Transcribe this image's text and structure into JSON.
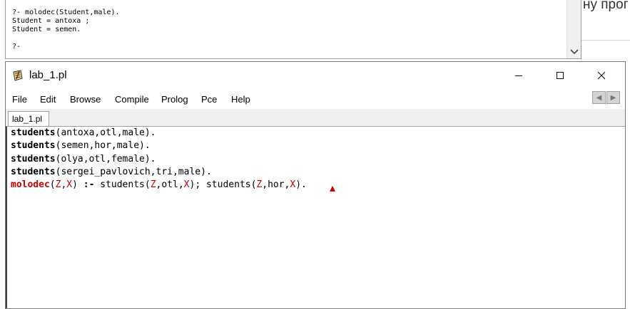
{
  "background_page": {
    "fragment_text": "ну прог"
  },
  "console": {
    "lines": [
      "?- molodec(Student,male).",
      "Student = antoxa ;",
      "Student = semen.",
      "",
      "?-"
    ]
  },
  "editor": {
    "title": "lab_1.pl",
    "window_controls": {
      "minimize": "—",
      "maximize": "☐",
      "close": "✕"
    },
    "menu": [
      "File",
      "Edit",
      "Browse",
      "Compile",
      "Prolog",
      "Pce",
      "Help"
    ],
    "tab_label": "lab_1.pl",
    "code": [
      [
        {
          "t": "students",
          "c": "pred"
        },
        {
          "t": "(antoxa,otl,male)."
        }
      ],
      [
        {
          "t": "students",
          "c": "pred"
        },
        {
          "t": "(semen,hor,male)."
        }
      ],
      [
        {
          "t": "students",
          "c": "pred"
        },
        {
          "t": "(olya,otl,female)."
        }
      ],
      [
        {
          "t": "students",
          "c": "pred"
        },
        {
          "t": "(sergei_pavlovich,tri,male)."
        }
      ],
      [
        {
          "t": "molodec",
          "c": "head"
        },
        {
          "t": "("
        },
        {
          "t": "Z",
          "c": "var"
        },
        {
          "t": ","
        },
        {
          "t": "X",
          "c": "var"
        },
        {
          "t": ") "
        },
        {
          "t": ":-",
          "c": "op"
        },
        {
          "t": " students("
        },
        {
          "t": "Z",
          "c": "var"
        },
        {
          "t": ",otl,"
        },
        {
          "t": "X",
          "c": "var"
        },
        {
          "t": "); students("
        },
        {
          "t": "Z",
          "c": "var"
        },
        {
          "t": ",hor,"
        },
        {
          "t": "X",
          "c": "var"
        },
        {
          "t": ")."
        }
      ]
    ]
  },
  "icons": {
    "app": "swi-prolog-icon",
    "scroll_down": "chevron-down-icon"
  }
}
